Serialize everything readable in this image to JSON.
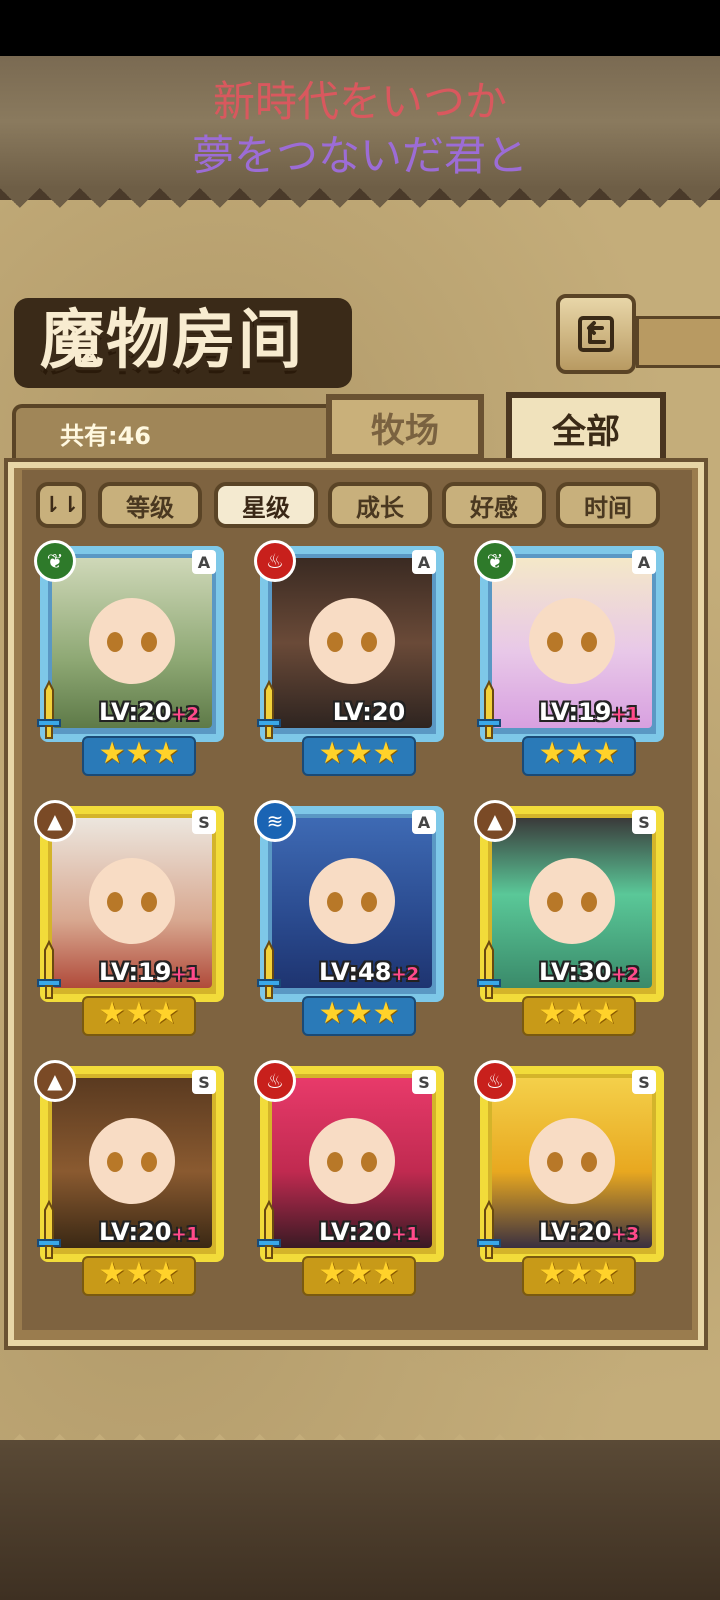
{
  "banner": {
    "line1": "新時代をいつか",
    "line2": "夢をつないだ君と"
  },
  "page": {
    "title": "魔物房间",
    "count_label": "共有:46"
  },
  "tabs": [
    {
      "label": "牧场",
      "active": false
    },
    {
      "label": "全部",
      "active": true
    }
  ],
  "sort": {
    "toggle_label": "⇂⇂",
    "buttons": [
      {
        "label": "等级",
        "active": false
      },
      {
        "label": "星级",
        "active": true
      },
      {
        "label": "成长",
        "active": false
      },
      {
        "label": "好感",
        "active": false
      },
      {
        "label": "时间",
        "active": false
      }
    ]
  },
  "monsters": [
    {
      "element": "grass",
      "rank": "A",
      "frame": "blue",
      "lv": "LV:20",
      "plus": "+2",
      "stars": 3
    },
    {
      "element": "fire",
      "rank": "A",
      "frame": "blue",
      "lv": "LV:20",
      "plus": "",
      "stars": 3
    },
    {
      "element": "grass",
      "rank": "A",
      "frame": "blue",
      "lv": "LV:19",
      "plus": "+1",
      "stars": 3
    },
    {
      "element": "earth",
      "rank": "S",
      "frame": "gold",
      "lv": "LV:19",
      "plus": "+1",
      "stars": 3
    },
    {
      "element": "water",
      "rank": "A",
      "frame": "blue",
      "lv": "LV:48",
      "plus": "+2",
      "stars": 3
    },
    {
      "element": "earth",
      "rank": "S",
      "frame": "gold",
      "lv": "LV:30",
      "plus": "+2",
      "stars": 3
    },
    {
      "element": "earth",
      "rank": "S",
      "frame": "gold",
      "lv": "LV:20",
      "plus": "+1",
      "stars": 3
    },
    {
      "element": "fire",
      "rank": "S",
      "frame": "gold",
      "lv": "LV:20",
      "plus": "+1",
      "stars": 3
    },
    {
      "element": "fire",
      "rank": "S",
      "frame": "gold",
      "lv": "LV:20",
      "plus": "+3",
      "stars": 3
    }
  ]
}
